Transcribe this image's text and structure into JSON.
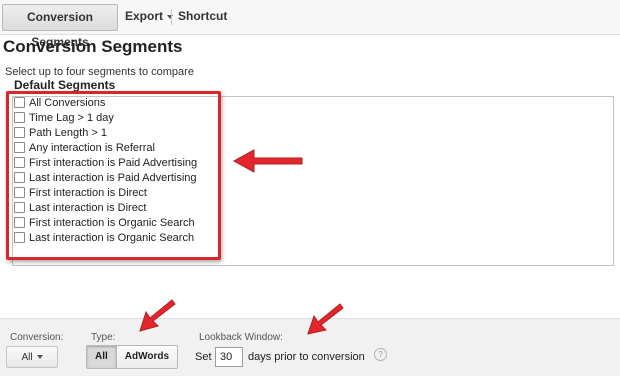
{
  "toolbar": {
    "conversion_segments": "Conversion Segments",
    "export": "Export",
    "shortcut": "Shortcut"
  },
  "page": {
    "title": "Conversion Segments",
    "instruction": "Select up to four segments to compare",
    "group_heading": "Default Segments"
  },
  "segments": [
    "All Conversions",
    "Time Lag > 1 day",
    "Path Length > 1",
    "Any interaction is Referral",
    "First interaction is Paid Advertising",
    "Last interaction is Paid Advertising",
    "First interaction is Direct",
    "Last interaction is Direct",
    "First interaction is Organic Search",
    "Last interaction is Organic Search"
  ],
  "footer": {
    "conversion_label": "Conversion:",
    "conversion_value": "All",
    "type_label": "Type:",
    "type_all": "All",
    "type_adwords": "AdWords",
    "lookback_label": "Lookback Window:",
    "lookback_set": "Set",
    "lookback_value": "30",
    "lookback_suffix": "days prior to conversion",
    "help": "?"
  },
  "colors": {
    "highlight": "#d8262a",
    "arrow": "#e2262b"
  },
  "icons": {
    "arrow": "red-arrow-icon",
    "dropdown": "caret-down-icon",
    "help": "question-icon"
  }
}
